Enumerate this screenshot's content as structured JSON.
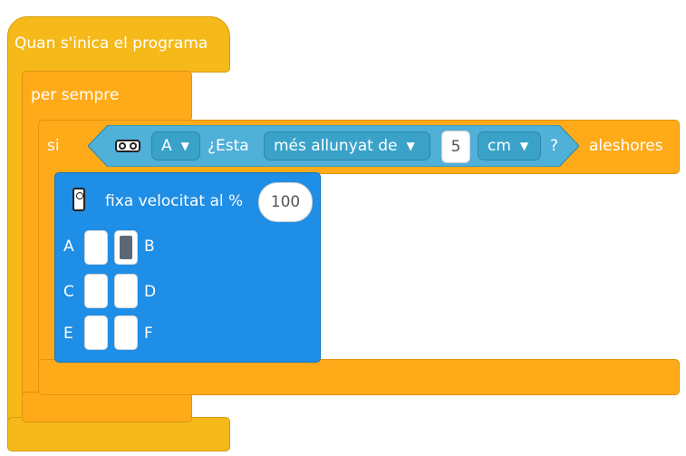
{
  "when_program_starts": {
    "label": "Quan s'inica el programa",
    "color": "#f5b91a"
  },
  "forever": {
    "label": "per sempre",
    "color": "#ffab19"
  },
  "if_block": {
    "if_label": "si",
    "then_label": "aleshores",
    "condition": {
      "sensor_icon": "distance-sensor-icon",
      "port": "A",
      "question": "¿Esta",
      "comparison": "més allunyat de",
      "value": "5",
      "unit": "cm",
      "end": "?",
      "color": "#4fb0d8"
    }
  },
  "motor_block": {
    "hub_icon": "hub-icon",
    "label": "fixa velocitat al %",
    "value": "100",
    "color": "#1f8ee6",
    "ports": [
      {
        "label": "A",
        "selected": false
      },
      {
        "label": "B",
        "selected": true
      },
      {
        "label": "C",
        "selected": false
      },
      {
        "label": "D",
        "selected": false
      },
      {
        "label": "E",
        "selected": false
      },
      {
        "label": "F",
        "selected": false
      }
    ]
  }
}
